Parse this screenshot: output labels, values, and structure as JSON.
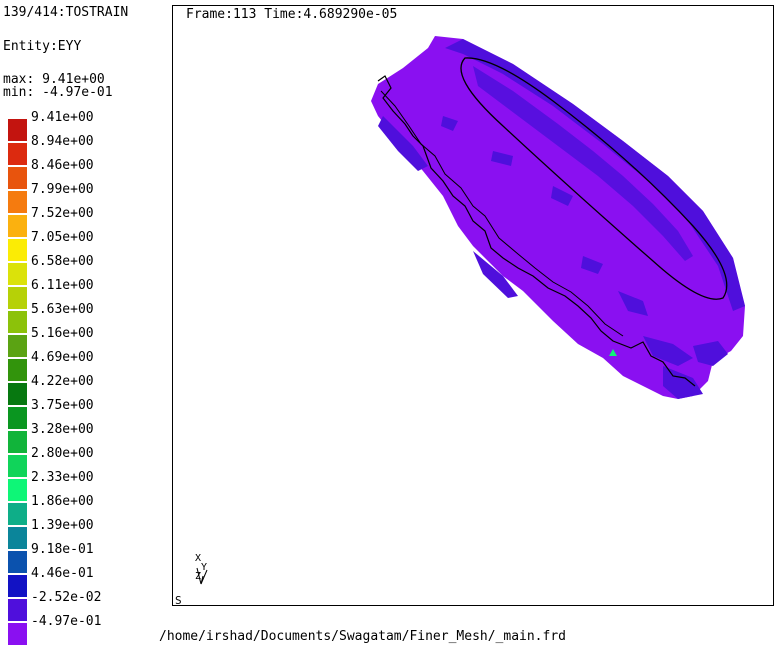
{
  "header": {
    "step_info": "139/414:TOSTRAIN",
    "entity": "Entity:EYY",
    "max": "max: 9.41e+00",
    "min": "min: -4.97e-01"
  },
  "legend": {
    "entries": [
      {
        "label": "9.41e+00",
        "color": "#c3140f"
      },
      {
        "label": "8.94e+00",
        "color": "#dc2a0f"
      },
      {
        "label": "8.46e+00",
        "color": "#e8540d"
      },
      {
        "label": "7.99e+00",
        "color": "#f57b0f"
      },
      {
        "label": "7.52e+00",
        "color": "#fbb10f"
      },
      {
        "label": "7.05e+00",
        "color": "#fbec05"
      },
      {
        "label": "6.58e+00",
        "color": "#dbe20a"
      },
      {
        "label": "6.11e+00",
        "color": "#b6d107"
      },
      {
        "label": "5.63e+00",
        "color": "#8cc20a"
      },
      {
        "label": "5.16e+00",
        "color": "#5ba313"
      },
      {
        "label": "4.69e+00",
        "color": "#32940c"
      },
      {
        "label": "4.22e+00",
        "color": "#077810"
      },
      {
        "label": "3.75e+00",
        "color": "#0a9620"
      },
      {
        "label": "3.28e+00",
        "color": "#11b43a"
      },
      {
        "label": "2.80e+00",
        "color": "#10d45a"
      },
      {
        "label": "2.33e+00",
        "color": "#0ef677"
      },
      {
        "label": "1.86e+00",
        "color": "#0eae88"
      },
      {
        "label": "1.39e+00",
        "color": "#0b859a"
      },
      {
        "label": "9.18e-01",
        "color": "#0b52ae"
      },
      {
        "label": "4.46e-01",
        "color": "#1212c4"
      },
      {
        "label": "-2.52e-02",
        "color": "#4f0fdc"
      },
      {
        "label": "-4.97e-01",
        "color": "#8a10f1"
      }
    ]
  },
  "viewport": {
    "frame_info": "Frame:113 Time:4.689290e-05",
    "axis_x": "X",
    "axis_y": "Y",
    "axis_z": "Z",
    "corner_label": "S"
  },
  "footer": {
    "file_path": "/home/irshad/Documents/Swagatam/Finer_Mesh/_main.frd"
  },
  "model": {
    "main_color": "#8a10f1",
    "patch_color": "#4f0fdc",
    "node_marker_color": "#0ef677"
  }
}
